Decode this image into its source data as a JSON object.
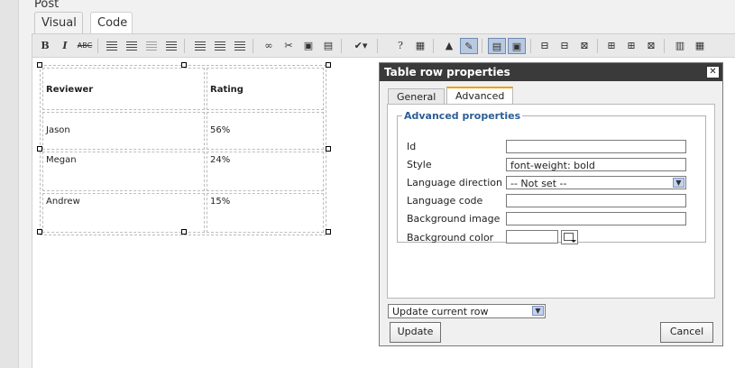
{
  "page": {
    "post_label": "Post"
  },
  "editor_tabs": {
    "visual": "Visual",
    "code": "Code"
  },
  "toolbar": {
    "bold": "B",
    "italic": "I",
    "strikethrough": "ABC"
  },
  "table": {
    "rows": [
      [
        "Reviewer",
        "Rating"
      ],
      [
        "Jason",
        "56%"
      ],
      [
        "Megan",
        "24%"
      ],
      [
        "Andrew",
        "15%"
      ]
    ]
  },
  "dialog": {
    "title": "Table row properties",
    "close_label": "✕",
    "tabs": {
      "general": "General",
      "advanced": "Advanced"
    },
    "legend": "Advanced properties",
    "labels": {
      "id": "Id",
      "style": "Style",
      "language_direction": "Language direction",
      "language_code": "Language code",
      "background_image": "Background image",
      "background_color": "Background color"
    },
    "values": {
      "id": "",
      "style": "font-weight: bold",
      "language_direction": "-- Not set --",
      "language_code": "",
      "background_image": "",
      "background_color": ""
    },
    "scope_select": "Update current row",
    "update_button": "Update",
    "cancel_button": "Cancel"
  }
}
